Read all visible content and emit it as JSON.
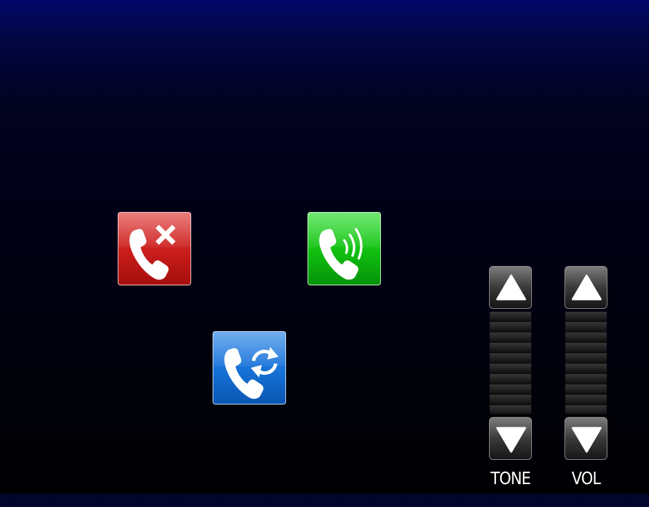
{
  "call_controls": {
    "reject": {
      "icon": "phone-reject-icon",
      "color": "#c81d1b"
    },
    "answer": {
      "icon": "phone-ringing-icon",
      "color": "#10bf10"
    },
    "swap": {
      "icon": "phone-swap-icon",
      "color": "#1671d6"
    }
  },
  "sliders": {
    "tone": {
      "label": "TONE",
      "up_icon": "arrow-up-icon",
      "down_icon": "arrow-down-icon"
    },
    "vol": {
      "label": "VOL",
      "up_icon": "arrow-up-icon",
      "down_icon": "arrow-down-icon"
    }
  },
  "colors": {
    "background_top": "#02076a",
    "background_bottom": "#000003"
  }
}
